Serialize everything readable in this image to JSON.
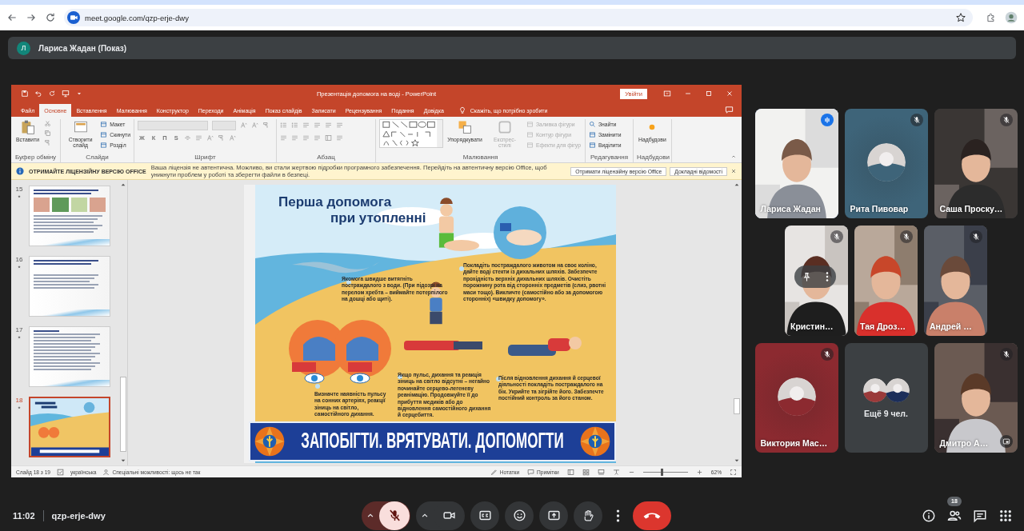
{
  "browser": {
    "url": "meet.google.com/qzp-erje-dwy"
  },
  "presenter_bar": {
    "initial": "Л",
    "label": "Лариса Жадан (Показ)"
  },
  "powerpoint": {
    "title": "Презентація допомога на воді - PowerPoint",
    "sign_in": "Увійти",
    "tabs": [
      {
        "label": "Файл",
        "selected": false
      },
      {
        "label": "Основне",
        "selected": true
      },
      {
        "label": "Вставлення",
        "selected": false
      },
      {
        "label": "Малювання",
        "selected": false
      },
      {
        "label": "Конструктор",
        "selected": false
      },
      {
        "label": "Переходи",
        "selected": false
      },
      {
        "label": "Анімація",
        "selected": false
      },
      {
        "label": "Показ слайдів",
        "selected": false
      },
      {
        "label": "Записати",
        "selected": false
      },
      {
        "label": "Рецензування",
        "selected": false
      },
      {
        "label": "Подання",
        "selected": false
      },
      {
        "label": "Довідка",
        "selected": false
      }
    ],
    "tell_me": "Скажіть, що потрібно зробити",
    "ribbon_groups": [
      {
        "label": "Буфер обміну",
        "items": [
          {
            "kind": "paste",
            "label": "Вставити",
            "disabled": false
          },
          {
            "kind": "clipboard-tools"
          }
        ]
      },
      {
        "label": "Слайди",
        "items": [
          {
            "kind": "new-slide",
            "label": "Створити слайд",
            "disabled": false
          },
          {
            "kind": "small-list",
            "labels": [
              "Макет",
              "Скинути",
              "Розділ"
            ],
            "disabled": false
          }
        ]
      },
      {
        "label": "Шрифт",
        "items": [
          {
            "kind": "font-controls",
            "glyphs": [
              "Ж",
              "К",
              "П",
              "S"
            ]
          }
        ]
      },
      {
        "label": "Абзац",
        "items": [
          {
            "kind": "paragraph-controls"
          }
        ]
      },
      {
        "label": "Малювання",
        "items": [
          {
            "kind": "shapes-gallery"
          },
          {
            "kind": "arrange",
            "label": "Упорядкувати",
            "disabled": false
          },
          {
            "kind": "quick-styles",
            "label": "Експрес-стилі",
            "disabled": true
          },
          {
            "kind": "small-list",
            "labels": [
              "Заливка фігури",
              "Контур фігури",
              "Ефекти для фігур"
            ],
            "disabled": true
          }
        ]
      },
      {
        "label": "Редагування",
        "items": [
          {
            "kind": "small-list",
            "labels": [
              "Знайти",
              "Замінити",
              "Виділити"
            ],
            "disabled": false
          }
        ]
      },
      {
        "label": "Надбудови",
        "items": [
          {
            "kind": "add-ins",
            "label": "Надбудови",
            "disabled": false
          }
        ]
      }
    ],
    "license_bar": {
      "title": "ОТРИМАЙТЕ ЛІЦЕНЗІЙНУ ВЕРСІЮ OFFICE",
      "message": "Ваша ліцензія не автентична. Можливо, ви стали жертвою підробки програмного забезпечення. Перейдіть на автентичну версію Office, щоб уникнути проблем у роботі та зберегти файли в безпеці.",
      "buttons": [
        "Отримати ліцензійну версію Office",
        "Докладні відомості"
      ]
    },
    "thumbnails": [
      {
        "number": "15",
        "kind": "text-with-images",
        "selected": false
      },
      {
        "number": "16",
        "kind": "text",
        "selected": false
      },
      {
        "number": "17",
        "kind": "list",
        "selected": false
      },
      {
        "number": "18",
        "kind": "poster",
        "selected": true
      }
    ],
    "slide": {
      "title": [
        "Перша допомога",
        "при утопленні"
      ],
      "captions": [
        "Якомога швидше витягніть постраждалого з води. (При підозрі на перелом хребта – виймайте потерпілого на дошці або щиті).",
        "Покладіть постраждалого животом на своє коліно, дайте воді стекти із дихальних шляхів. Забезпечте прохідність верхніх дихальних шляхів. Очистіть порожнину рота від сторонніх предметів (слиз, рвотні маси тощо). Викличте (самостійно або за допомогою сторонніх) «швидку допомогу».",
        "Визначте наявність пульсу на сонних артеріях, реакції зіниць на світло, самостійного дихання.",
        "Якщо пульс, дихання та реакція зіниць на світло відсутні – негайно починайте серцево-легеневу реанімацію. Продовжуйте її до прибуття медиків або до відновлення самостійного дихання й серцебиття.",
        "Після відновлення дихання й серцевої діяльності покладіть постраждалого на бік. Укрийте та зігрійте його. Забезпечте постійний контроль за його станом."
      ],
      "banner": "ЗАПОБІГТИ. ВРЯТУВАТИ. ДОПОМОГТИ"
    },
    "status_bar": {
      "slide_counter": "Слайд 18 з 19",
      "language": "українська",
      "accessibility": "Спеціальні можливості: щось не так",
      "notes": "Нотатки",
      "comments": "Примітки",
      "zoom": {
        "level": 0.42
      },
      "zoom_reading": "62%"
    }
  },
  "participants": {
    "rows": [
      [
        {
          "name": "Лариса Жадан",
          "kind": "camera",
          "muted": false,
          "speaking": true
        },
        {
          "name": "Рита Пивовар",
          "kind": "avatar",
          "muted": true,
          "speaking": false,
          "color": "#3e6479"
        },
        {
          "name": "Саша Проску…",
          "kind": "camera",
          "muted": true,
          "speaking": false
        }
      ],
      [
        {
          "name": "Кристин…",
          "kind": "camera",
          "muted": true,
          "speaking": false,
          "hovered": true
        },
        {
          "name": "Тая Дроз…",
          "kind": "camera",
          "muted": true,
          "speaking": false
        },
        {
          "name": "Андрей …",
          "kind": "camera",
          "muted": true,
          "speaking": false
        }
      ],
      [
        {
          "name": "Виктория Мас…",
          "kind": "avatar",
          "muted": true,
          "speaking": false,
          "color": "#8c2a30"
        },
        {
          "name": "Ещё 9 чел.",
          "kind": "more"
        },
        {
          "name": "Дмитро А…",
          "kind": "self",
          "muted": true,
          "speaking": false
        }
      ]
    ]
  },
  "bottom_bar": {
    "time": "11:02",
    "meeting_code": "qzp-erje-dwy",
    "controls": [
      {
        "kind": "mic",
        "muted": true
      },
      {
        "kind": "camera",
        "muted": false
      },
      {
        "kind": "captions"
      },
      {
        "kind": "emoji"
      },
      {
        "kind": "present"
      },
      {
        "kind": "hand"
      },
      {
        "kind": "more"
      },
      {
        "kind": "leave"
      }
    ],
    "side_buttons": [
      {
        "kind": "info"
      },
      {
        "kind": "people",
        "badge": "18"
      },
      {
        "kind": "chat"
      },
      {
        "kind": "activities"
      }
    ]
  }
}
